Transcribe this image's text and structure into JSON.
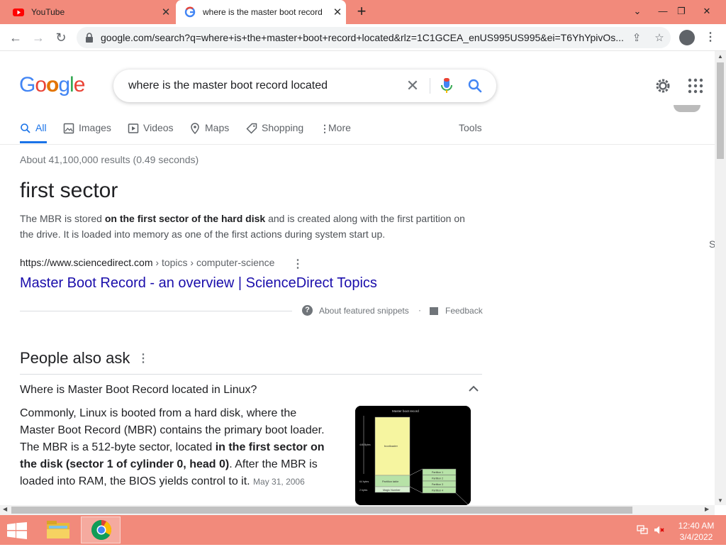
{
  "browser": {
    "tabs": [
      {
        "title": "YouTube",
        "active": false
      },
      {
        "title": "where is the master boot record",
        "active": true
      }
    ],
    "url": "google.com/search?q=where+is+the+master+boot+record+located&rlz=1C1GCEA_enUS995US995&ei=T6YhYpivOs..."
  },
  "search": {
    "query": "where is the master boot record located",
    "logo_text": [
      "G",
      "o",
      "o",
      "g",
      "l",
      "e"
    ]
  },
  "nav_tabs": [
    {
      "label": "All",
      "icon": "search-icon",
      "active": true
    },
    {
      "label": "Images",
      "icon": "image-icon",
      "active": false
    },
    {
      "label": "Videos",
      "icon": "video-icon",
      "active": false
    },
    {
      "label": "Maps",
      "icon": "map-pin-icon",
      "active": false
    },
    {
      "label": "Shopping",
      "icon": "tag-icon",
      "active": false
    },
    {
      "label": "More",
      "icon": "more-vert-icon",
      "active": false
    }
  ],
  "tools_label": "Tools",
  "right_clip": "S",
  "stats": "About 41,100,000 results (0.49 seconds)",
  "featured": {
    "answer": "first sector",
    "snippet_pre": "The MBR is stored ",
    "snippet_bold": "on the first sector of the hard disk",
    "snippet_post": " and is created along with the first partition on the drive. It is loaded into memory as one of the first actions during system start up.",
    "cite_host": "https://www.sciencedirect.com",
    "cite_path": " › topics › computer-science",
    "link_title": "Master Boot Record - an overview | ScienceDirect Topics",
    "about_label": "About featured snippets",
    "dot": "·",
    "feedback_label": "Feedback"
  },
  "paa": {
    "title": "People also ask",
    "question": "Where is Master Boot Record located in Linux?",
    "answer_pre": "Commonly, Linux is booted from a hard disk, where the Master Boot Record (MBR) contains the primary boot loader. The MBR is a 512-byte sector, located ",
    "answer_bold": "in the first sector on the disk (sector 1 of cylinder 0, head 0)",
    "answer_post": ". After the MBR is loaded into RAM, the BIOS yields control to it. ",
    "date": "May 31, 2006",
    "image_labels": {
      "header": "Master boot record",
      "bytes446": "446 Bytes",
      "bytes64": "64 bytes",
      "bytes2": "2 bytes",
      "bootloader": "bootloader",
      "partition_table": "Partition table",
      "magic": "Magic Number",
      "p1": "Partition 1",
      "p2": "Partition 2",
      "p3": "Partition 3",
      "p4": "Partition 4"
    }
  },
  "taskbar": {
    "time": "12:40 AM",
    "date": "3/4/2022"
  },
  "colors": {
    "chrome_frame": "#f28a7b",
    "link": "#1a0dab",
    "accent": "#1a73e8"
  }
}
